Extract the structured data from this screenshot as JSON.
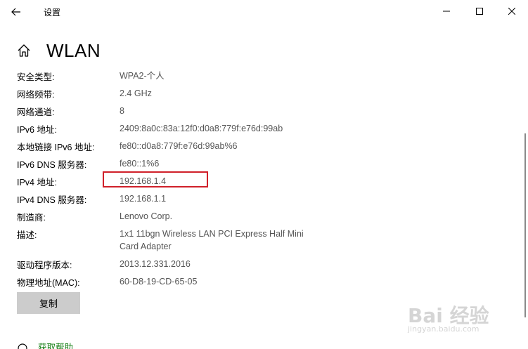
{
  "titlebar": {
    "back_icon": "back-arrow-icon",
    "app_title": "设置",
    "minimize_icon": "minimize-icon",
    "maximize_icon": "maximize-icon",
    "close_icon": "close-icon"
  },
  "header": {
    "home_icon": "home-icon",
    "title": "WLAN"
  },
  "properties": [
    {
      "label": "安全类型:",
      "value": "WPA2-个人"
    },
    {
      "label": "网络频带:",
      "value": "2.4 GHz"
    },
    {
      "label": "网络通道:",
      "value": "8"
    },
    {
      "label": "IPv6 地址:",
      "value": "2409:8a0c:83a:12f0:d0a8:779f:e76d:99ab"
    },
    {
      "label": "本地链接 IPv6 地址:",
      "value": "fe80::d0a8:779f:e76d:99ab%6"
    },
    {
      "label": "IPv6 DNS 服务器:",
      "value": "fe80::1%6"
    },
    {
      "label": "IPv4 地址:",
      "value": "192.168.1.4"
    },
    {
      "label": "IPv4 DNS 服务器:",
      "value": "192.168.1.1"
    },
    {
      "label": "制造商:",
      "value": "Lenovo Corp."
    },
    {
      "label": "描述:",
      "value_lines": [
        "1x1 11bgn Wireless LAN PCI Express Half Mini",
        "Card Adapter"
      ]
    },
    {
      "label": "驱动程序版本:",
      "value": "2013.12.331.2016"
    },
    {
      "label": "物理地址(MAC):",
      "value": "60-D8-19-CD-65-05"
    }
  ],
  "copy_button": {
    "label": "复制"
  },
  "help": {
    "icon": "help-icon",
    "label": "获取帮助"
  },
  "highlight_color": "#d0202a",
  "watermark": {
    "logo": "Bai 经验",
    "sub": "jingyan.baidu.com"
  }
}
